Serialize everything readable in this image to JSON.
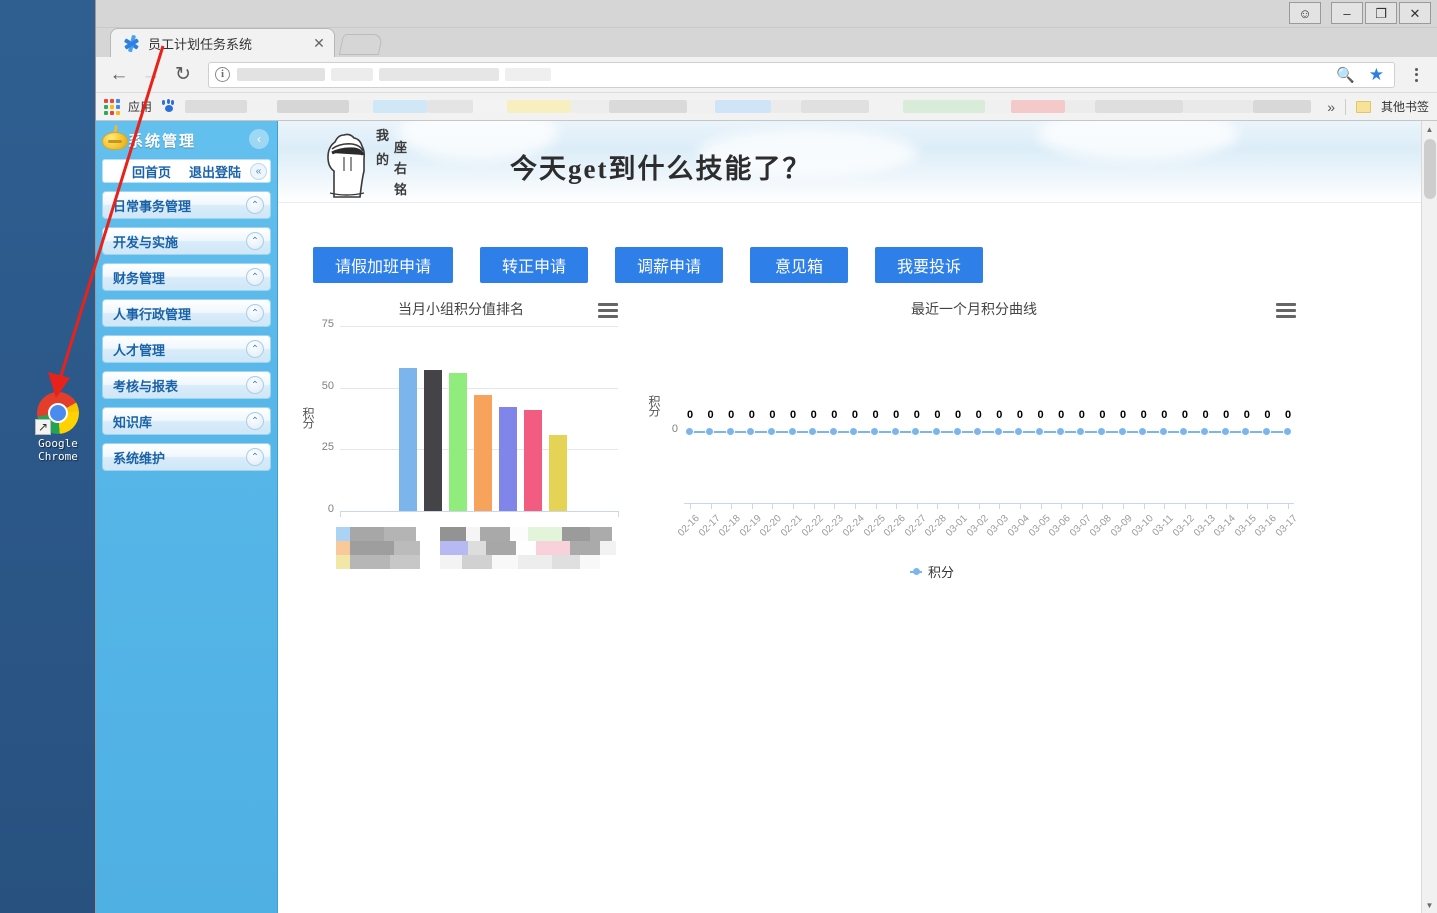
{
  "desktop": {
    "icon_label": "Google\nChrome",
    "icon_name": "google-chrome-shortcut"
  },
  "window": {
    "controls": {
      "profile": "person-icon",
      "minimize": "–",
      "maximize": "❐",
      "close": "✕"
    }
  },
  "browser": {
    "tab": {
      "title": "员工计划任务系统",
      "close_label": "✕",
      "favicon": "blue-star-favicon"
    },
    "newtab_label": "",
    "toolbar": {
      "back": "←",
      "forward": "→",
      "reload": "↻",
      "site_info": "i",
      "url_value": "",
      "url_placeholder": "",
      "zoom_icon": "search-icon",
      "bookmark_icon": "star-icon",
      "menu_icon": "kebab-menu-icon"
    },
    "bookmarks": {
      "apps_label": "应用",
      "overflow_label": "»",
      "other_label": "其他书签"
    }
  },
  "sidebar": {
    "title": "系统管理",
    "collapse_label": "‹",
    "quick_links": [
      {
        "label": "回首页"
      },
      {
        "label": "退出登陆"
      }
    ],
    "quick_toggle": "«",
    "items": [
      {
        "label": "日常事务管理",
        "expander": "»"
      },
      {
        "label": "开发与实施",
        "expander": "»"
      },
      {
        "label": "财务管理",
        "expander": "»"
      },
      {
        "label": "人事行政管理",
        "expander": "»"
      },
      {
        "label": "人才管理",
        "expander": "»"
      },
      {
        "label": "考核与报表",
        "expander": "»"
      },
      {
        "label": "知识库",
        "expander": "»"
      },
      {
        "label": "系统维护",
        "expander": "»"
      }
    ]
  },
  "banner": {
    "motto_chars": [
      "我",
      "的",
      "座",
      "右",
      "铭"
    ],
    "title": "今天get到什么技能了？",
    "fist_icon": "fist-icon"
  },
  "actions": [
    {
      "label": "请假加班申请"
    },
    {
      "label": "转正申请"
    },
    {
      "label": "调薪申请"
    },
    {
      "label": "意见箱"
    },
    {
      "label": "我要投诉"
    }
  ],
  "chart_data": [
    {
      "type": "bar",
      "title": "当月小组积分值排名",
      "xlabel": "",
      "ylabel": "积分",
      "ylim": [
        0,
        75
      ],
      "yticks": [
        0,
        25,
        50,
        75
      ],
      "grid": true,
      "legend_position": "bottom",
      "legend_redacted": true,
      "categories": [
        "",
        "",
        "",
        "",
        "",
        "",
        ""
      ],
      "values": [
        58,
        57,
        56,
        47,
        42,
        41,
        31
      ],
      "colors": [
        "#7cb5ec",
        "#434348",
        "#90ed7d",
        "#f7a35c",
        "#8085e9",
        "#f15c80",
        "#e4d354"
      ]
    },
    {
      "type": "line",
      "title": "最近一个月积分曲线",
      "xlabel": "",
      "ylabel": "积分",
      "ylim": [
        0,
        0
      ],
      "yticks": [
        0
      ],
      "grid": false,
      "legend_position": "bottom",
      "series": [
        {
          "name": "积分",
          "color": "#7cb5ec",
          "values": [
            0,
            0,
            0,
            0,
            0,
            0,
            0,
            0,
            0,
            0,
            0,
            0,
            0,
            0,
            0,
            0,
            0,
            0,
            0,
            0,
            0,
            0,
            0,
            0,
            0,
            0,
            0,
            0,
            0,
            0
          ]
        }
      ],
      "x": [
        "02-16",
        "02-17",
        "02-18",
        "02-19",
        "02-20",
        "02-21",
        "02-22",
        "02-23",
        "02-24",
        "02-25",
        "02-26",
        "02-27",
        "02-28",
        "03-01",
        "03-02",
        "03-03",
        "03-04",
        "03-05",
        "03-06",
        "03-07",
        "03-08",
        "03-09",
        "03-10",
        "03-11",
        "03-12",
        "03-13",
        "03-14",
        "03-15",
        "03-16",
        "03-17"
      ],
      "data_labels": [
        "0",
        "0",
        "0",
        "0",
        "0",
        "0",
        "0",
        "0",
        "0",
        "0",
        "0",
        "0",
        "0",
        "0",
        "0",
        "0",
        "0",
        "0",
        "0",
        "0",
        "0",
        "0",
        "0",
        "0",
        "0",
        "0",
        "0",
        "0",
        "0",
        "0"
      ]
    }
  ],
  "colors": {
    "accent": "#2f7fe8",
    "sidebar": "#56b6e8",
    "sidebar_text": "#1a62a8",
    "line_series": "#7cb5ec"
  }
}
